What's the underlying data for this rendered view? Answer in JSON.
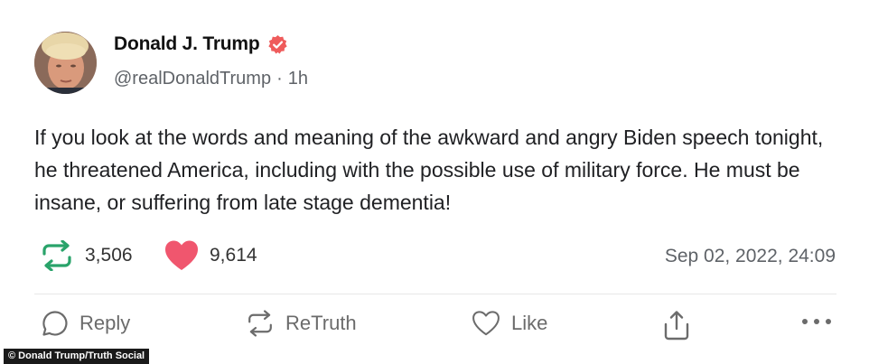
{
  "post": {
    "author": {
      "display_name": "Donald J. Trump",
      "handle": "@realDonaldTrump",
      "separator": "·",
      "time_ago": "1h",
      "verified_color": "#ef5c5c"
    },
    "body": "If you look at the words and meaning of the awkward and angry Biden speech tonight, he threatened America, including with the possible use of military force. He must be insane, or suffering from late stage dementia!",
    "stats": {
      "retruths": "3,506",
      "likes": "9,614",
      "retruth_icon": "retruth-icon",
      "heart_icon": "heart-icon",
      "retruth_color": "#29a36a",
      "heart_color": "#f0566e"
    },
    "timestamp": "Sep 02, 2022, 24:09",
    "actions": {
      "reply_label": "Reply",
      "retruth_label": "ReTruth",
      "like_label": "Like"
    }
  },
  "credit": "© Donald Trump/Truth Social"
}
